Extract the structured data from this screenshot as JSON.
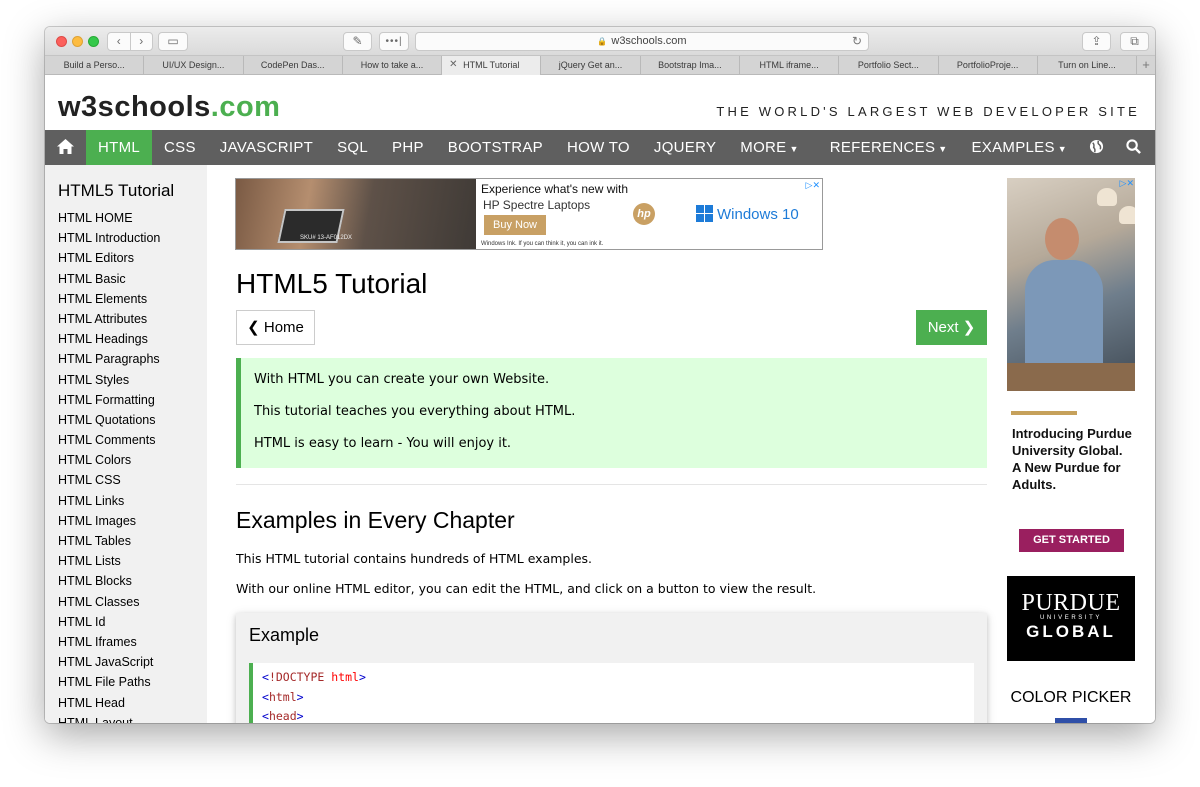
{
  "browser": {
    "url": "w3schools.com",
    "tabs": [
      {
        "label": "Build a Perso..."
      },
      {
        "label": "UI/UX Design..."
      },
      {
        "label": "CodePen Das..."
      },
      {
        "label": "How to take a..."
      },
      {
        "label": "HTML Tutorial",
        "active": true
      },
      {
        "label": "jQuery Get an..."
      },
      {
        "label": "Bootstrap Ima..."
      },
      {
        "label": "HTML iframe..."
      },
      {
        "label": "Portfolio Sect..."
      },
      {
        "label": "PortfolioProje..."
      },
      {
        "label": "Turn on Line..."
      }
    ]
  },
  "header": {
    "logo_main": "w3schools",
    "logo_suffix": ".com",
    "tagline": "THE WORLD'S LARGEST WEB DEVELOPER SITE"
  },
  "topnav": {
    "home_icon": "home-icon",
    "html": "HTML",
    "css": "CSS",
    "javascript": "JAVASCRIPT",
    "sql": "SQL",
    "php": "PHP",
    "bootstrap": "BOOTSTRAP",
    "howto": "HOW TO",
    "jquery": "JQUERY",
    "more": "MORE",
    "references": "REFERENCES",
    "examples": "EXAMPLES",
    "globe_icon": "globe-icon",
    "search_icon": "search-icon",
    "accent_color": "#4caf50",
    "bar_color": "#5f5f5f"
  },
  "sidebar": {
    "title": "HTML5 Tutorial",
    "items": [
      "HTML HOME",
      "HTML Introduction",
      "HTML Editors",
      "HTML Basic",
      "HTML Elements",
      "HTML Attributes",
      "HTML Headings",
      "HTML Paragraphs",
      "HTML Styles",
      "HTML Formatting",
      "HTML Quotations",
      "HTML Comments",
      "HTML Colors",
      "HTML CSS",
      "HTML Links",
      "HTML Images",
      "HTML Tables",
      "HTML Lists",
      "HTML Blocks",
      "HTML Classes",
      "HTML Id",
      "HTML Iframes",
      "HTML JavaScript",
      "HTML File Paths",
      "HTML Head",
      "HTML Layout"
    ]
  },
  "ad_top": {
    "headline": "Experience what's new with",
    "product": "HP Spectre Laptops",
    "cta": "Buy Now",
    "sku": "SKU# 13-AF012DX",
    "fineprint": "Windows Ink. If you can think it, you can ink it.",
    "hp": "hp",
    "windows": "Windows 10"
  },
  "main": {
    "title": "HTML5 Tutorial",
    "home_button": "Home",
    "next_button": "Next",
    "note_lines": [
      "With HTML you can create your own Website.",
      "This tutorial teaches you everything about HTML.",
      "HTML is easy to learn - You will enjoy it."
    ],
    "section_title": "Examples in Every Chapter",
    "para1": "This HTML tutorial contains hundreds of HTML examples.",
    "para2": "With our online HTML editor, you can edit the HTML, and click on a button to view the result.",
    "example_title": "Example",
    "code_lines": [
      {
        "open": "<",
        "tag": "!DOCTYPE",
        "attr": " html",
        "close": ">"
      },
      {
        "open": "<",
        "tag": "html",
        "attr": "",
        "close": ">"
      },
      {
        "open": "<",
        "tag": "head",
        "attr": "",
        "close": ">"
      }
    ]
  },
  "ad_side": {
    "headline": "Introducing Purdue University Global. A New Purdue for Adults.",
    "cta": "GET STARTED",
    "brand_top": "PURDUE",
    "brand_mid": "UNIVERSITY",
    "brand_bottom": "GLOBAL"
  },
  "right": {
    "color_picker": "COLOR PICKER"
  }
}
